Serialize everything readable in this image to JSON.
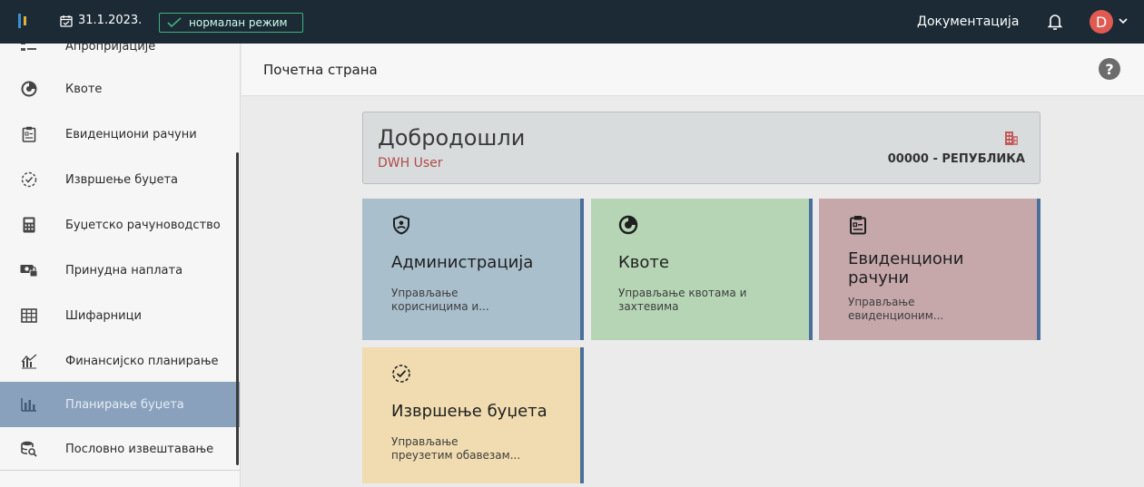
{
  "topbar": {
    "date": "31.1.2023.",
    "mode": "нормалан режим",
    "docs_label": "Документација",
    "avatar_letter": "D"
  },
  "sidebar": {
    "items": [
      {
        "label": "Апропријације",
        "icon": "list-icon"
      },
      {
        "label": "Квоте",
        "icon": "quota-icon"
      },
      {
        "label": "Евиденциони рачуни",
        "icon": "clipboard-icon"
      },
      {
        "label": "Извршење буџета",
        "icon": "check-circle-icon"
      },
      {
        "label": "Буџетско рачуноводство",
        "icon": "calculator-icon"
      },
      {
        "label": "Принудна наплата",
        "icon": "cash-lock-icon"
      },
      {
        "label": "Шифарници",
        "icon": "table-icon"
      },
      {
        "label": "Финансијско планирање",
        "icon": "chart-trend-icon"
      },
      {
        "label": "Планирање буџета",
        "icon": "bar-chart-icon",
        "active": true
      },
      {
        "label": "Пословно извештавање",
        "icon": "db-search-icon"
      }
    ]
  },
  "header": {
    "title": "Почетна страна",
    "help": "?"
  },
  "welcome": {
    "title": "Добродошли",
    "user": "DWH User",
    "org": "00000 - РЕПУБЛИКА"
  },
  "tiles": [
    {
      "title": "Администрација",
      "desc_1": "Управљање",
      "desc_2": "корисницима и..."
    },
    {
      "title": "Квоте",
      "desc_1": "Управљање квотама и",
      "desc_2": "захтевима"
    },
    {
      "title_1": "Евиденциони",
      "title_2": "рачуни",
      "desc_1": "Управљање",
      "desc_2": "евиденционим..."
    },
    {
      "title": "Извршење буџета",
      "desc_1": "Управљање",
      "desc_2": "преузетим обавезам..."
    }
  ],
  "colors": {
    "topbar": "#1c2a35",
    "accent_green": "#3fb27f",
    "tile_admin": "#a9bfcc",
    "tile_quota": "#b5d5b5",
    "tile_records": "#c6a8ab",
    "tile_budget": "#f0dcb0",
    "tile_edge": "#4b6f9a",
    "sidebar_active": "#8aa1bd"
  }
}
